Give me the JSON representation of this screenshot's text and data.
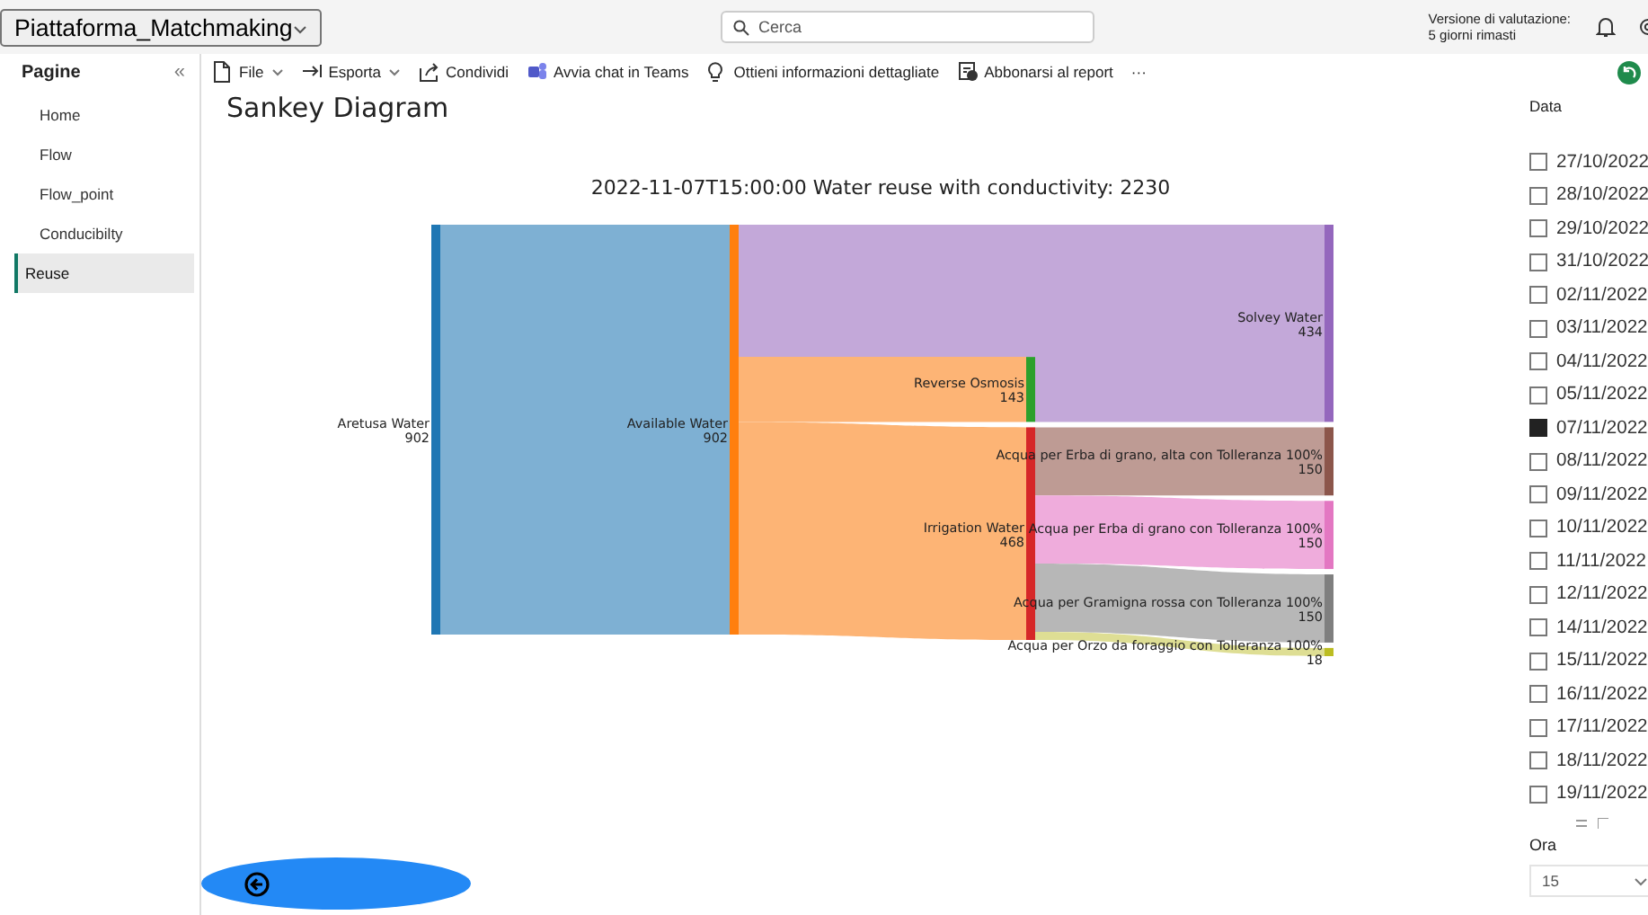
{
  "top_bar": {
    "app_name": "Piattaforma_Matchmaking",
    "search": {
      "placeholder": "Cerca"
    },
    "trial_notice": [
      "Versione di valutazione:",
      "5 giorni rimasti"
    ]
  },
  "sidebar": {
    "title": "Pagine",
    "collapse": "«",
    "items": [
      {
        "label": "Home",
        "selected": false
      },
      {
        "label": "Flow",
        "selected": false
      },
      {
        "label": "Flow_point",
        "selected": false
      },
      {
        "label": "Conducibilty",
        "selected": false
      },
      {
        "label": "Reuse",
        "selected": true
      }
    ]
  },
  "toolbar": {
    "items": [
      {
        "label": "File",
        "kind": "menu"
      },
      {
        "label": "Esporta",
        "kind": "menu"
      },
      {
        "label": "Condividi",
        "kind": "action"
      },
      {
        "label": "Avvia chat in Teams",
        "kind": "action"
      },
      {
        "label": "Ottieni informazioni dettagliate",
        "kind": "action"
      },
      {
        "label": "Abbonarsi al report",
        "kind": "action"
      }
    ],
    "more": "···"
  },
  "page": {
    "title": "Sankey Diagram",
    "diagram": {
      "title": "2022-11-07T15:00:00 Water reuse with conductivity: 2230",
      "nodes": [
        {
          "label": "Aretusa Water",
          "value": "902",
          "color": "#1f77b4"
        },
        {
          "label": "Available Water",
          "value": "902",
          "color": "#ff7f0e"
        },
        {
          "label": "Solvey Water",
          "value": "434",
          "color": "#9467bd"
        },
        {
          "label": "Reverse Osmosis",
          "value": "143",
          "color": "#2ca02c"
        },
        {
          "label": "Irrigation Water",
          "value": "468",
          "color": "#d62728"
        },
        {
          "label": "Acqua per Erba di grano, alta con Tolleranza 100%",
          "value": "150",
          "color": "#8c564b"
        },
        {
          "label": "Acqua per Erba di grano con Tolleranza 100%",
          "value": "150",
          "color": "#e377c2"
        },
        {
          "label": "Acqua per Gramigna rossa con Tolleranza 100%",
          "value": "150",
          "color": "#7f7f7f"
        },
        {
          "label": "Acqua per Orzo da foraggio con Tolleranza 100%",
          "value": "18",
          "color": "#bcbd22"
        }
      ],
      "links": [
        {
          "color": "#77acd1"
        },
        {
          "color": "#c0a3d7"
        },
        {
          "color": "#fdb06e"
        },
        {
          "color": "#fdb06e"
        },
        {
          "color": "#c0a3d7"
        },
        {
          "color": "#bb968e"
        },
        {
          "color": "#eea8da"
        },
        {
          "color": "#b3b3b3"
        },
        {
          "color": "#dcdc8e"
        }
      ]
    }
  },
  "date_filter": {
    "title": "Data",
    "dates": [
      {
        "label": "27/10/2022",
        "checked": false
      },
      {
        "label": "28/10/2022",
        "checked": false
      },
      {
        "label": "29/10/2022",
        "checked": false
      },
      {
        "label": "31/10/2022",
        "checked": false
      },
      {
        "label": "02/11/2022",
        "checked": false
      },
      {
        "label": "03/11/2022",
        "checked": false
      },
      {
        "label": "04/11/2022",
        "checked": false
      },
      {
        "label": "05/11/2022",
        "checked": false
      },
      {
        "label": "07/11/2022",
        "checked": true
      },
      {
        "label": "08/11/2022",
        "checked": false
      },
      {
        "label": "09/11/2022",
        "checked": false
      },
      {
        "label": "10/11/2022",
        "checked": false
      },
      {
        "label": "11/11/2022",
        "checked": false
      },
      {
        "label": "12/11/2022",
        "checked": false
      },
      {
        "label": "14/11/2022",
        "checked": false
      },
      {
        "label": "15/11/2022",
        "checked": false
      },
      {
        "label": "16/11/2022",
        "checked": false
      },
      {
        "label": "17/11/2022",
        "checked": false
      },
      {
        "label": "18/11/2022",
        "checked": false
      },
      {
        "label": "19/11/2022",
        "checked": false
      }
    ]
  },
  "hour_filter": {
    "title": "Ora",
    "value": "15"
  }
}
